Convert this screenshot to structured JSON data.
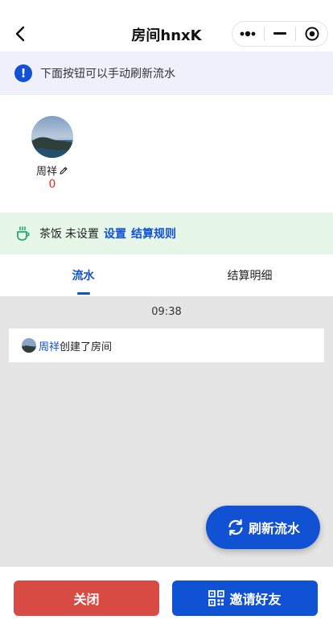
{
  "nav": {
    "title": "房间hnxK",
    "back_icon": "chevron-left-icon",
    "capsule": {
      "more_icon": "more-dots-icon",
      "minimize_icon": "minimize-icon",
      "close_icon": "target-close-icon"
    }
  },
  "notice": {
    "icon": "info-icon",
    "icon_glyph": "!",
    "text": "下面按钮可以手动刷新流水"
  },
  "players": [
    {
      "name": "周祥",
      "score": "0",
      "edit_icon": "pencil-icon"
    }
  ],
  "tea": {
    "icon": "tea-cup-icon",
    "label": "茶饭",
    "status": "未设置",
    "set_link": "设置",
    "rules_link": "结算规则"
  },
  "tabs": [
    {
      "label": "流水",
      "active": true
    },
    {
      "label": "结算明细",
      "active": false
    }
  ],
  "feed": {
    "time": "09:38",
    "items": [
      {
        "name": "周祥",
        "action": "创建了房间"
      }
    ]
  },
  "refresh_button": {
    "label": "刷新流水",
    "icon": "refresh-icon"
  },
  "bottom": {
    "close_label": "关闭",
    "invite_label": "邀请好友",
    "invite_icon": "qrcode-icon"
  },
  "colors": {
    "primary_blue": "#1151d3",
    "close_red": "#d84b44",
    "notice_bg": "#eff0fb",
    "tea_bg": "#e6f7ea",
    "feed_bg": "#e5e5e5",
    "score_red": "#e32b2b"
  }
}
